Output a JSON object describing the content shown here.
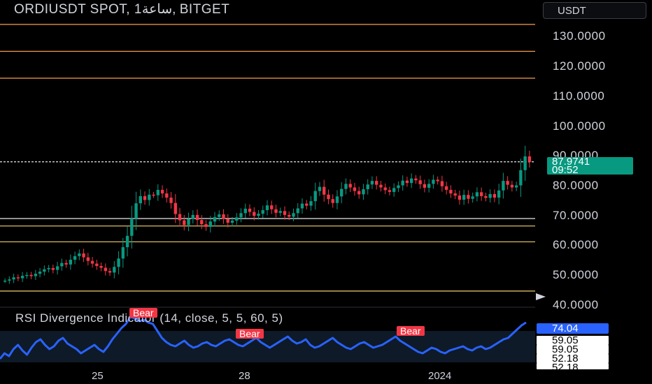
{
  "header": {
    "title": "ORDIUSDT SPOT, 1ساعة, BITGET",
    "currency": "USDT"
  },
  "price_axis": {
    "labels": [
      "130.0000",
      "120.0000",
      "110.0000",
      "100.0000",
      "90.0000",
      "80.0000",
      "70.0000",
      "60.0000",
      "50.0000",
      "40.0000"
    ]
  },
  "last_price": {
    "value": "87.9741",
    "countdown": "09:52"
  },
  "indicator": {
    "title": "RSI Divergence Indicator (14, close, 5, 5, 60, 5)",
    "bear_label": "Bear",
    "current_value": "74.04",
    "levels": [
      "59.05",
      "59.05",
      "52.18",
      "52.18"
    ]
  },
  "time_axis": {
    "labels": [
      "25",
      "28",
      "2024"
    ]
  },
  "colors": {
    "up": "#089981",
    "down": "#f23645",
    "rsi": "#2962ff",
    "orange_line": "#f7a14d",
    "yellow_line": "#f2d06b"
  },
  "chart_data": {
    "type": "candlestick",
    "y_range": [
      40,
      134
    ],
    "horizontal_lines": [
      {
        "price": 134.0,
        "color": "orange"
      },
      {
        "price": 125.0,
        "color": "orange"
      },
      {
        "price": 116.0,
        "color": "orange"
      },
      {
        "price": 88.0,
        "color": "white",
        "style": "dashed"
      },
      {
        "price": 69.0,
        "color": "white"
      },
      {
        "price": 66.5,
        "color": "yellow"
      },
      {
        "price": 61.2,
        "color": "yellow"
      },
      {
        "price": 44.7,
        "color": "yellow"
      }
    ],
    "close_series": [
      48.2,
      48.6,
      49.3,
      49.0,
      49.8,
      50.1,
      49.7,
      50.5,
      51.2,
      52.0,
      52.4,
      51.8,
      53.0,
      54.1,
      53.6,
      55.2,
      56.4,
      57.3,
      56.0,
      54.8,
      53.9,
      53.1,
      52.5,
      51.4,
      50.9,
      52.8,
      55.6,
      59.4,
      63.2,
      69.0,
      74.1,
      76.5,
      75.2,
      77.0,
      76.8,
      78.6,
      77.4,
      76.0,
      74.2,
      70.5,
      68.4,
      66.8,
      68.9,
      70.2,
      68.5,
      67.1,
      66.2,
      68.0,
      69.5,
      70.4,
      68.9,
      67.6,
      68.3,
      69.4,
      70.8,
      72.3,
      71.2,
      69.9,
      70.6,
      71.8,
      73.4,
      72.1,
      70.9,
      71.5,
      70.2,
      69.6,
      70.8,
      72.4,
      74.0,
      73.3,
      74.8,
      78.2,
      79.6,
      77.0,
      75.5,
      74.2,
      76.4,
      78.9,
      80.6,
      79.4,
      78.2,
      77.1,
      78.8,
      80.4,
      81.6,
      80.3,
      79.4,
      78.5,
      77.9,
      79.2,
      80.1,
      81.7,
      80.9,
      82.4,
      81.8,
      80.5,
      79.3,
      80.6,
      82.0,
      81.5,
      79.8,
      78.6,
      77.4,
      76.7,
      75.3,
      76.9,
      75.6,
      76.4,
      77.8,
      76.5,
      75.9,
      77.2,
      76.0,
      78.4,
      81.6,
      80.3,
      79.4,
      80.1,
      85.2,
      89.8,
      87.97
    ],
    "rsi": {
      "y_range": [
        40,
        80
      ],
      "values": [
        48,
        52,
        50,
        55,
        58,
        54,
        51,
        56,
        60,
        62,
        58,
        55,
        57,
        61,
        63,
        59,
        57,
        55,
        52,
        54,
        56,
        58,
        55,
        53,
        57,
        62,
        66,
        70,
        73,
        78,
        77,
        75,
        76,
        74,
        73,
        68,
        63,
        60,
        58,
        57,
        59,
        61,
        58,
        56,
        57,
        59,
        60,
        58,
        57,
        59,
        61,
        62,
        60,
        58,
        57,
        59,
        61,
        63,
        60,
        58,
        56,
        58,
        60,
        62,
        64,
        61,
        59,
        60,
        62,
        58,
        56,
        57,
        59,
        61,
        63,
        60,
        58,
        56,
        55,
        57,
        59,
        60,
        58,
        56,
        57,
        58,
        60,
        62,
        64,
        61,
        59,
        57,
        55,
        53,
        52,
        54,
        56,
        55,
        53,
        52,
        54,
        55,
        56,
        57,
        55,
        54,
        56,
        57,
        55,
        56,
        58,
        60,
        62,
        63,
        66,
        69,
        72,
        74.04
      ]
    }
  }
}
